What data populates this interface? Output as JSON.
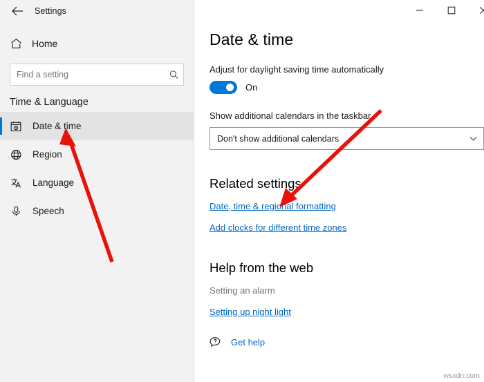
{
  "window": {
    "app_title": "Settings",
    "back_icon": "back-arrow-icon",
    "caption": {
      "minimize": "minimize-icon",
      "maximize": "maximize-icon",
      "close": "close-icon"
    }
  },
  "sidebar": {
    "home_label": "Home",
    "home_icon": "home-icon",
    "search": {
      "placeholder": "Find a setting",
      "value": "",
      "icon": "search-icon"
    },
    "section_title": "Time & Language",
    "items": [
      {
        "label": "Date & time",
        "icon": "calendar-clock-icon",
        "selected": true
      },
      {
        "label": "Region",
        "icon": "globe-icon",
        "selected": false
      },
      {
        "label": "Language",
        "icon": "language-icon",
        "selected": false
      },
      {
        "label": "Speech",
        "icon": "microphone-icon",
        "selected": false
      }
    ]
  },
  "main": {
    "page_title": "Date & time",
    "daylight": {
      "label": "Adjust for daylight saving time automatically",
      "state": "On",
      "enabled": true
    },
    "calendars": {
      "label": "Show additional calendars in the taskbar",
      "selected": "Don't show additional calendars",
      "chevron": "chevron-down-icon"
    },
    "related": {
      "title": "Related settings",
      "links": [
        "Date, time & regional formatting",
        "Add clocks for different time zones"
      ]
    },
    "help": {
      "title": "Help from the web",
      "items": [
        {
          "text": "Setting an alarm",
          "link": false
        },
        {
          "text": "Setting up night light",
          "link": true
        }
      ],
      "get_help_label": "Get help",
      "get_help_icon": "question-bubble-icon"
    }
  },
  "annotations": {
    "arrow_color": "#e8120b",
    "arrows": [
      {
        "name": "arrow-to-date-and-time",
        "target": "Date & time"
      },
      {
        "name": "arrow-to-regional-formatting-link",
        "target": "Date, time & regional formatting"
      }
    ]
  },
  "watermark": "wsxdn.com"
}
